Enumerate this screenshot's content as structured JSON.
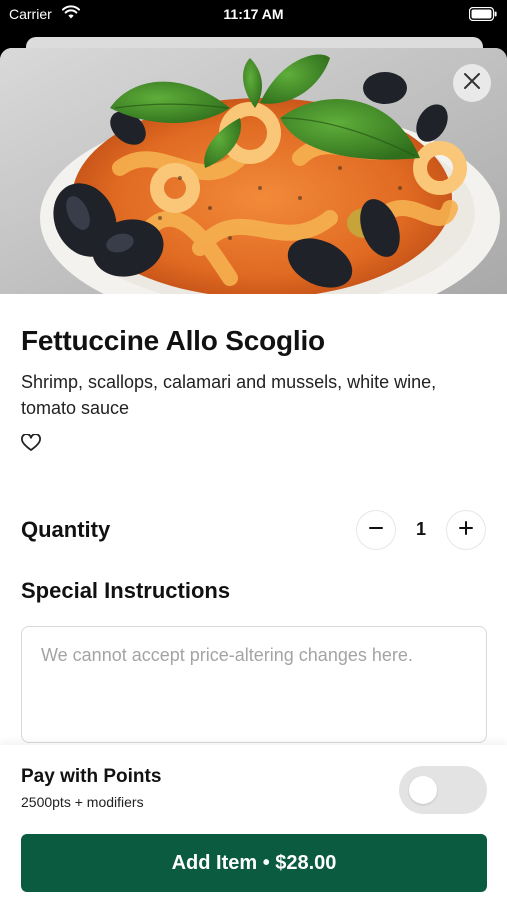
{
  "status_bar": {
    "carrier": "Carrier",
    "time": "11:17 AM"
  },
  "icons": {
    "wifi": "wifi-icon",
    "battery": "battery-icon",
    "close": "close-icon",
    "favorite": "heart-icon",
    "minus": "minus-icon",
    "plus": "plus-icon"
  },
  "item": {
    "name": "Fettuccine Allo Scoglio",
    "description": "Shrimp, scallops, calamari and mussels, white wine, tomato sauce"
  },
  "quantity": {
    "label": "Quantity",
    "value": "1"
  },
  "special_instructions": {
    "label": "Special Instructions",
    "placeholder": "We cannot accept price-altering changes here."
  },
  "points": {
    "title": "Pay with Points",
    "subtitle": "2500pts + modifiers",
    "enabled": false
  },
  "add_button": {
    "label": "Add Item • $28.00"
  },
  "colors": {
    "accent": "#0a5b3f",
    "toggle_off": "#e3e3e3"
  }
}
